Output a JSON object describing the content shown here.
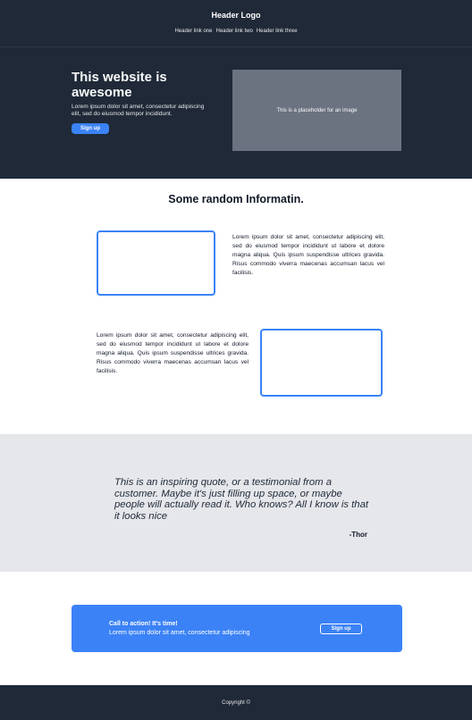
{
  "header": {
    "logo": "Header Logo",
    "links": [
      "Header link one",
      "Header link two",
      "Header link three"
    ]
  },
  "hero": {
    "title": "This website is awesome",
    "description": "Lorem ipsum dolor sit amet, consectetur adipiscing elit, sed do eiusmod tempor incididunt.",
    "button_label": "Sign up",
    "image_placeholder": "This is a placeholder for an image"
  },
  "info": {
    "title": "Some random Informatin.",
    "blocks": [
      {
        "text": "Lorem ipsum dolor sit amet, consectetur adipiscing elit, sed do eiusmod tempor incididunt ut labore et dolore magna aliqua. Quis ipsum suspendisse ultrices gravida. Risus commodo viverra maecenas accumsan lacus vel facilisis."
      },
      {
        "text": "Lorem ipsum dolor sit amet, consectetur adipiscing elit, sed do eiusmod tempor incididunt ut labore et dolore magna aliqua. Quis ipsum suspendisse ultrices gravida. Risus commodo viverra maecenas accumsan lacus vel facilisis."
      }
    ]
  },
  "quote": {
    "text": "This is an inspiring quote, or a testimonial from a customer. Maybe it's just filling up space, or maybe people will actually read it. Who knows? All I know is that it looks nice",
    "author": "-Thor"
  },
  "cta": {
    "title": "Call to action! It's time!",
    "description": "Lorem ipsum dolor sit amet, consectetur adipiscing",
    "button_label": "Sign up"
  },
  "footer": {
    "copyright": "Copyright ©"
  },
  "colors": {
    "dark": "#1f2937",
    "accent": "#3b82f6",
    "quote_bg": "#e5e7eb"
  }
}
